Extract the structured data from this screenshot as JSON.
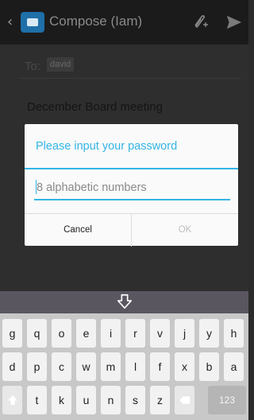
{
  "actionbar": {
    "title": "Compose (Iam)"
  },
  "compose": {
    "to_label": "To:",
    "to_chip": "david",
    "subject": "December Board meeting"
  },
  "dialog": {
    "title": "Please input your password",
    "password_placeholder": "8 alphabetic numbers",
    "cancel_label": "Cancel",
    "ok_label": "OK"
  },
  "keyboard": {
    "row1": [
      "g",
      "q",
      "o",
      "e",
      "i",
      "r",
      "v",
      "j",
      "y",
      "h"
    ],
    "row2": [
      "d",
      "p",
      "c",
      "w",
      "m",
      "l",
      "f",
      "x",
      "b",
      "a"
    ],
    "row3": [
      "t",
      "k",
      "u",
      "n",
      "s",
      "z"
    ],
    "mode_label": "123"
  },
  "icons": [
    "back-chevron-icon",
    "email-app-icon",
    "attach-icon",
    "send-icon",
    "keyboard-hide-icon",
    "shift-icon",
    "delete-icon"
  ]
}
